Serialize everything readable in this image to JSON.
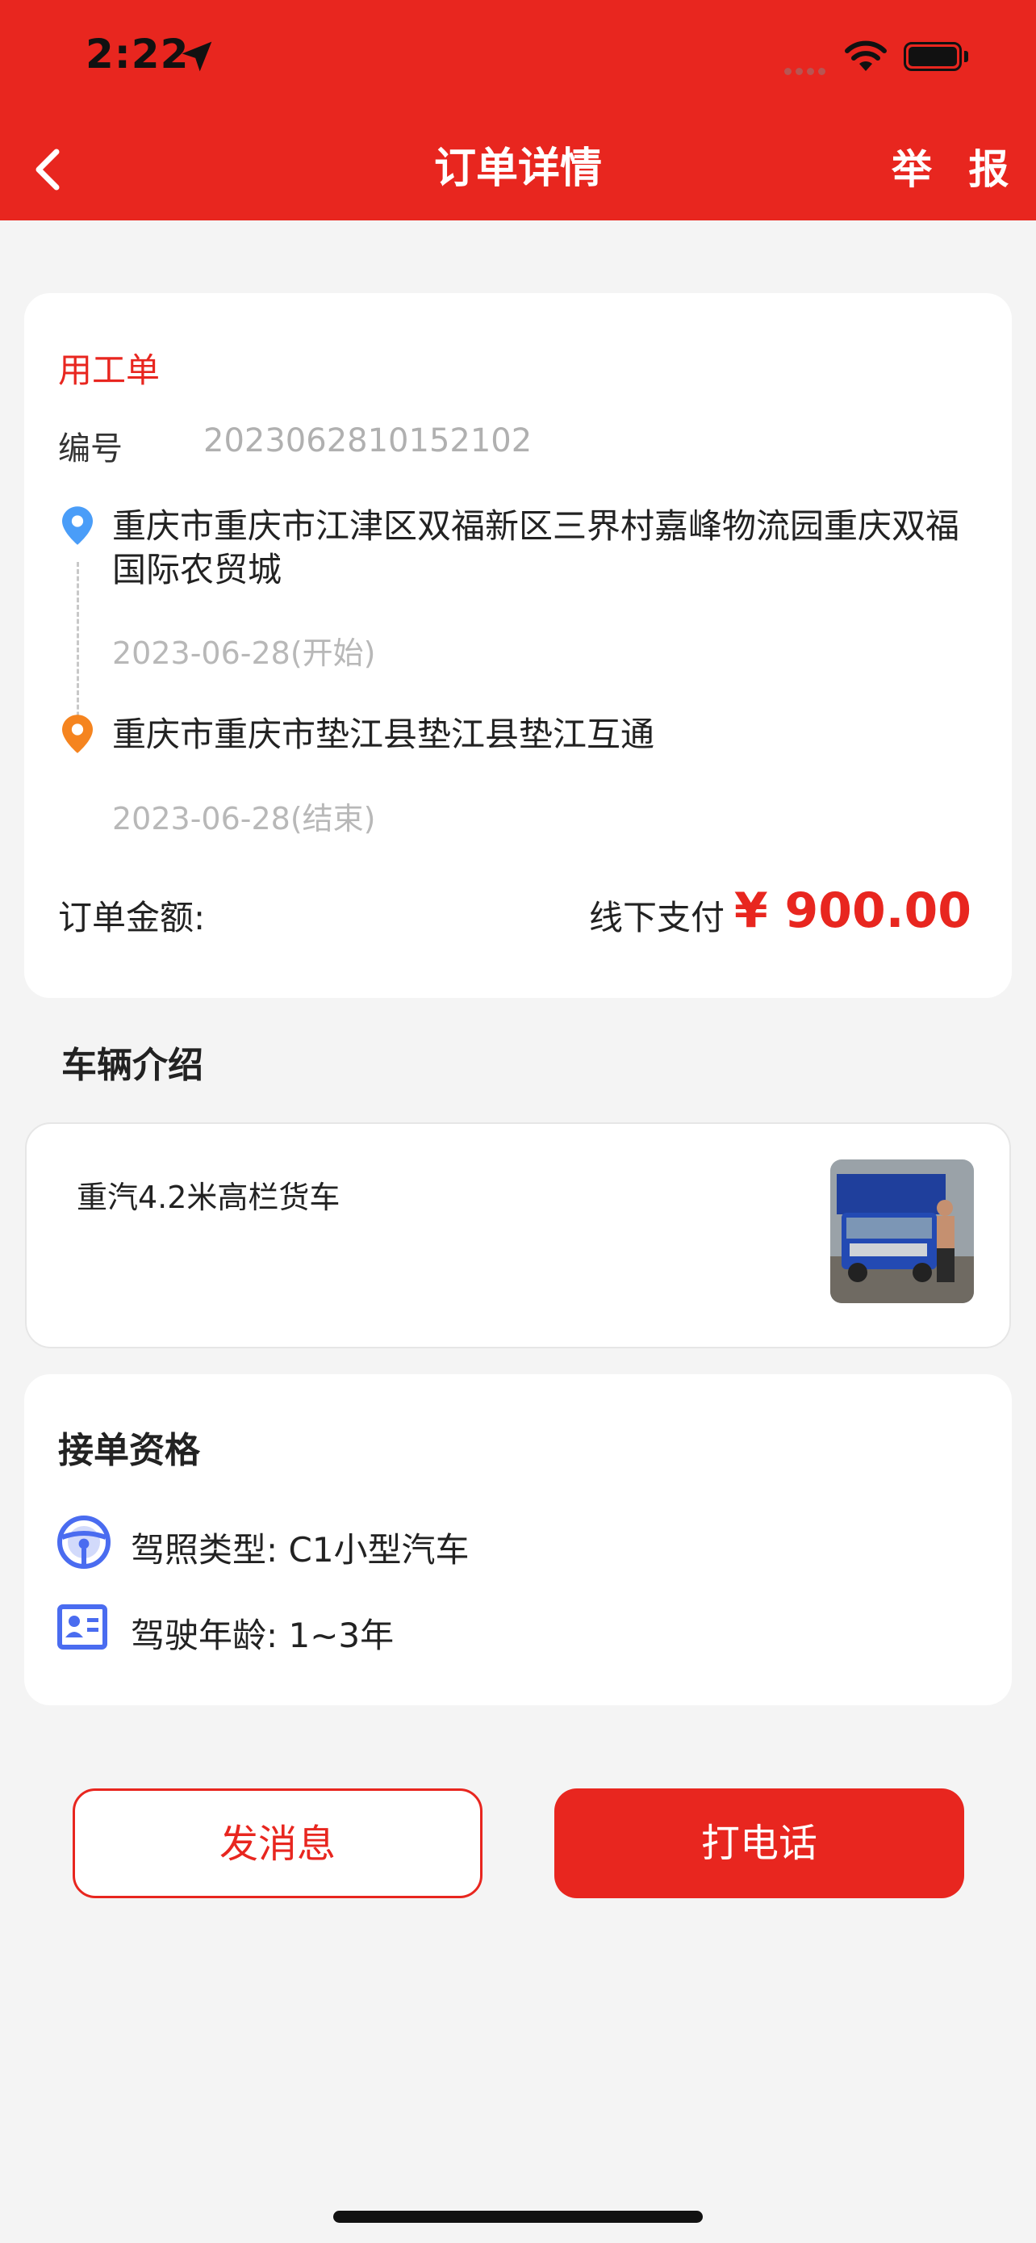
{
  "status_bar": {
    "time": "2:22"
  },
  "header": {
    "title": "订单详情",
    "report_label": "举 报"
  },
  "order": {
    "type": "用工单",
    "serial_label": "编号",
    "serial_value": "2023062810152102",
    "from_address": "重庆市重庆市江津区双福新区三界村嘉峰物流园重庆双福国际农贸城",
    "start_date": "2023-06-28(开始)",
    "to_address": "重庆市重庆市垫江县垫江县垫江互通",
    "end_date": "2023-06-28(结束)",
    "amount_label": "订单金额:",
    "pay_method": "线下支付",
    "amount": "¥ 900.00"
  },
  "vehicle": {
    "section_title": "车辆介绍",
    "description": "重汽4.2米高栏货车"
  },
  "qualification": {
    "title": "接单资格",
    "license_type": "驾照类型:  C1小型汽车",
    "driving_years": "驾驶年龄:  1~3年"
  },
  "actions": {
    "message_label": "发消息",
    "call_label": "打电话"
  },
  "colors": {
    "brand": "#e8261f",
    "pin_start": "#4a9df8",
    "pin_end": "#f5841f",
    "qual_icon": "#4a6cf0"
  },
  "icons": [
    "back-chevron-icon",
    "location-arrow-icon",
    "wifi-icon",
    "battery-icon",
    "map-pin-icon",
    "steering-wheel-icon",
    "id-card-icon"
  ]
}
